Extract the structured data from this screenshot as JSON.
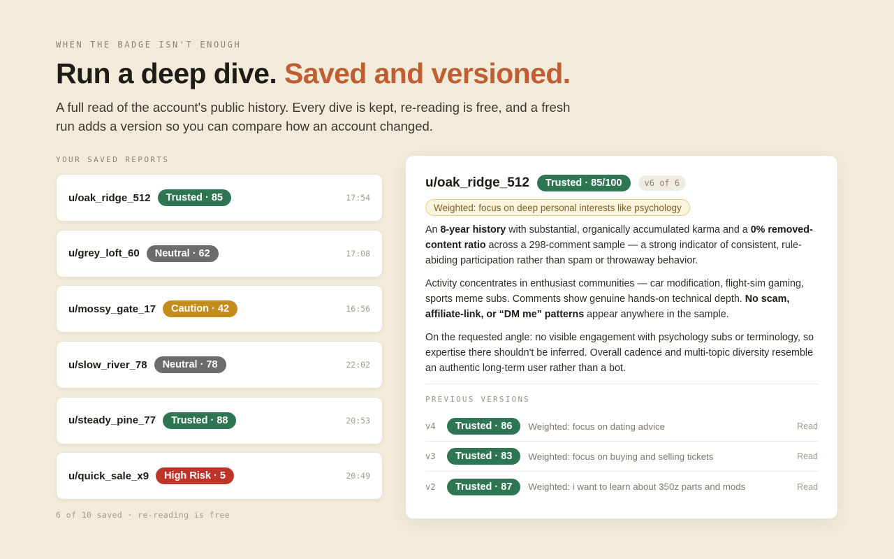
{
  "hero": {
    "eyebrow": "WHEN THE BADGE ISN'T ENOUGH",
    "title_main": "Run a deep dive.",
    "title_accent": "Saved and versioned.",
    "subtitle": "A full read of the account's public history. Every dive is kept, re-reading is free, and a fresh run adds a version so you can compare how an account changed."
  },
  "saved_reports": {
    "label": "YOUR SAVED REPORTS",
    "items": [
      {
        "user": "u/oak_ridge_512",
        "badge": "Trusted · 85",
        "status": "trusted",
        "time": "17:54"
      },
      {
        "user": "u/grey_loft_60",
        "badge": "Neutral · 62",
        "status": "neutral",
        "time": "17:08"
      },
      {
        "user": "u/mossy_gate_17",
        "badge": "Caution · 42",
        "status": "caution",
        "time": "16:56"
      },
      {
        "user": "u/slow_river_78",
        "badge": "Neutral · 78",
        "status": "neutral",
        "time": "22:02"
      },
      {
        "user": "u/steady_pine_77",
        "badge": "Trusted · 88",
        "status": "trusted",
        "time": "20:53"
      },
      {
        "user": "u/quick_sale_x9",
        "badge": "High Risk · 5",
        "status": "high",
        "time": "20:49"
      }
    ],
    "footer": "6 of 10 saved · re-reading is free"
  },
  "detail": {
    "user": "u/oak_ridge_512",
    "badge": "Trusted · 85/100",
    "version": "v6 of 6",
    "weighting": "Weighted: focus on deep personal interests like psychology",
    "p1": {
      "t1": "An ",
      "b1": "8-year history",
      "t2": " with substantial, organically accumulated karma and a ",
      "b2": "0% removed-content ratio",
      "t3": " across a 298-comment sample — a strong indicator of consistent, rule-abiding participation rather than spam or throwaway behavior."
    },
    "p2": {
      "t1": "Activity concentrates in enthusiast communities — car modification, flight-sim gaming, sports meme subs. Comments show genuine hands-on technical depth. ",
      "b1": "No scam, affiliate-link, or “DM me” patterns",
      "t2": " appear anywhere in the sample."
    },
    "p3": "On the requested angle: no visible engagement with psychology subs or terminology, so expertise there shouldn't be inferred. Overall cadence and multi-topic diversity resemble an authentic long-term user rather than a bot.",
    "previous_label": "PREVIOUS VERSIONS",
    "previous": [
      {
        "version": "v4",
        "badge": "Trusted · 86",
        "note": "Weighted: focus on dating advice",
        "action": "Read"
      },
      {
        "version": "v3",
        "badge": "Trusted · 83",
        "note": "Weighted: focus on buying and selling tickets",
        "action": "Read"
      },
      {
        "version": "v2",
        "badge": "Trusted · 87",
        "note": "Weighted: i want to learn about 350z parts and mods",
        "action": "Read"
      }
    ]
  },
  "colors": {
    "background": "#f3ebda",
    "accent": "#bd5f33",
    "trusted": "#2e7553",
    "neutral": "#6c6c6c",
    "caution": "#c38c1d",
    "high_risk": "#bd3428"
  }
}
